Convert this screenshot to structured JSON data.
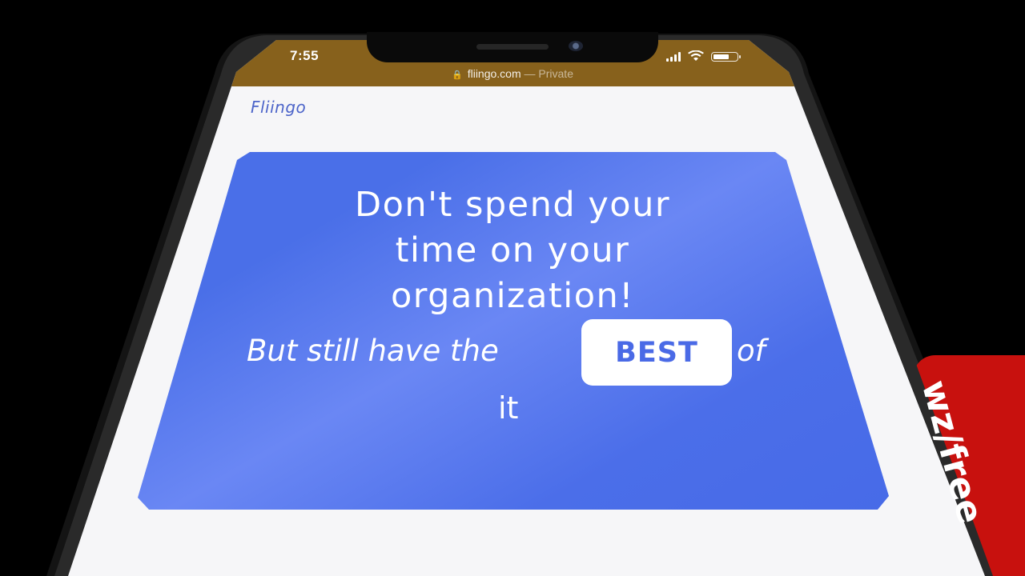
{
  "status_bar": {
    "time": "7:55",
    "battery_level": 0.7,
    "color": "#87611c"
  },
  "address_bar": {
    "domain": "fliingo.com",
    "suffix": "— Private",
    "icon": "lock-icon"
  },
  "site": {
    "brand": "Fliingo"
  },
  "hero": {
    "headline": "Don't spend your time on your organization!",
    "subline_prefix": "But still have the",
    "badge": "BEST",
    "subline_suffix": "of",
    "subline_end": "it",
    "card_color": "#4a6fe8",
    "badge_text_color": "#4a6ae6"
  },
  "side_tab": {
    "text": "wz/free",
    "color": "#c8110e"
  }
}
